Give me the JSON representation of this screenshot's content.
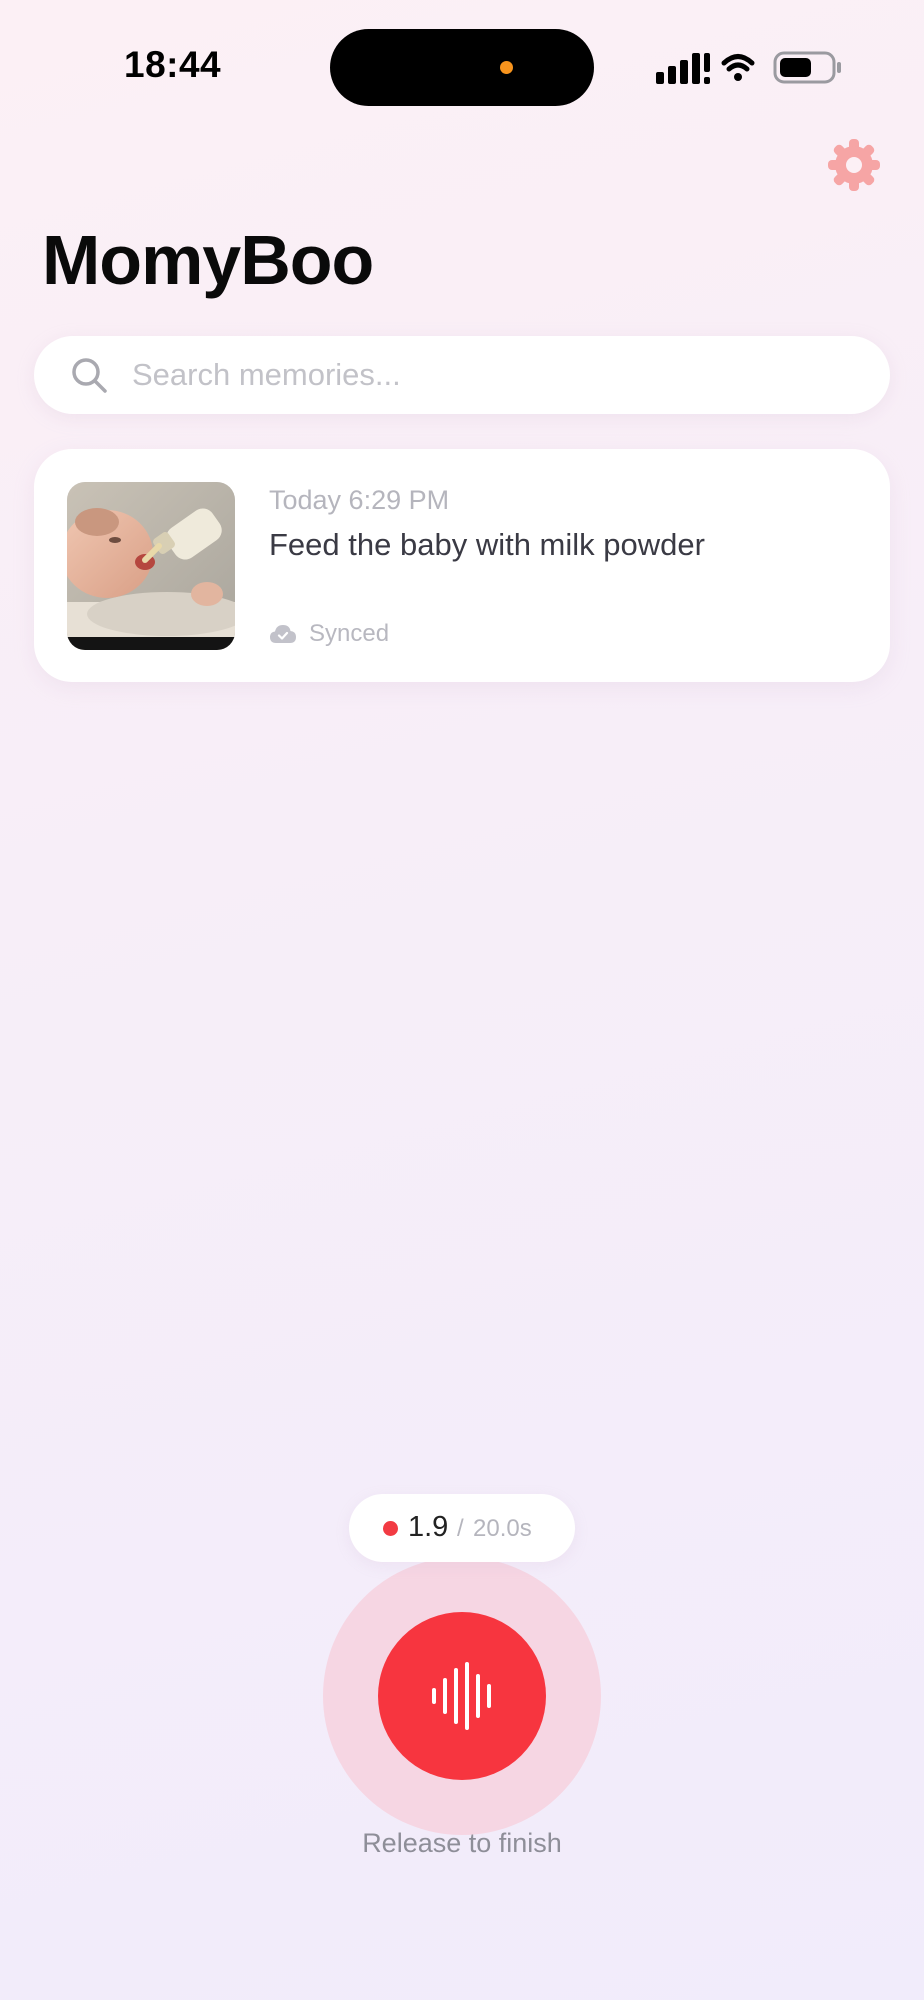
{
  "status_bar": {
    "time": "18:44"
  },
  "header": {
    "title": "MomyBoo",
    "settings_icon": "gear-icon",
    "accent_color": "#f6a5a5"
  },
  "search": {
    "placeholder": "Search memories...",
    "value": ""
  },
  "memories": [
    {
      "date": "Today 6:29 PM",
      "text": "Feed the baby with milk powder",
      "sync_status": "Synced",
      "sync_icon": "cloud-check-icon",
      "thumbnail": "baby-bottle-feeding-photo"
    }
  ],
  "recorder": {
    "elapsed": "1.9",
    "separator": "/",
    "max_duration": "20.0s",
    "hint": "Release to finish",
    "button_color": "#f7353f",
    "icon": "waveform-icon"
  }
}
